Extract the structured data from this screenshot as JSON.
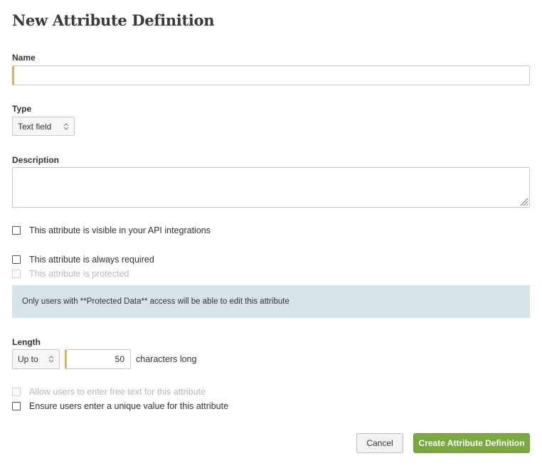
{
  "page": {
    "title": "New Attribute Definition"
  },
  "form": {
    "name": {
      "label": "Name",
      "value": ""
    },
    "type": {
      "label": "Type",
      "selected": "Text field"
    },
    "description": {
      "label": "Description",
      "value": ""
    },
    "checkboxes": {
      "api_visible": {
        "label": "This attribute is visible in your API integrations",
        "checked": false
      },
      "always_required": {
        "label": "This attribute is always required",
        "checked": false
      },
      "protected": {
        "label": "This attribute is protected",
        "checked": false,
        "disabled": true
      }
    },
    "protected_notice": "Only users with **Protected Data** access will be able to edit this attribute",
    "length": {
      "label": "Length",
      "mode_selected": "Up to",
      "value": "50",
      "suffix": "characters long"
    },
    "options": {
      "free_text": {
        "label": "Allow users to enter free text for this attribute",
        "checked": false,
        "disabled": true
      },
      "unique_value": {
        "label": "Ensure users enter a unique value for this attribute",
        "checked": false
      }
    }
  },
  "actions": {
    "cancel_label": "Cancel",
    "create_label": "Create Attribute Definition"
  },
  "colors": {
    "input_focus_accent": "#e0b060",
    "notice_background": "#d6e3ea",
    "primary_button": "#7aaa3f"
  },
  "icons": {
    "select_arrows": "updown-arrows-icon",
    "resize_grip": "resize-grip-icon"
  }
}
